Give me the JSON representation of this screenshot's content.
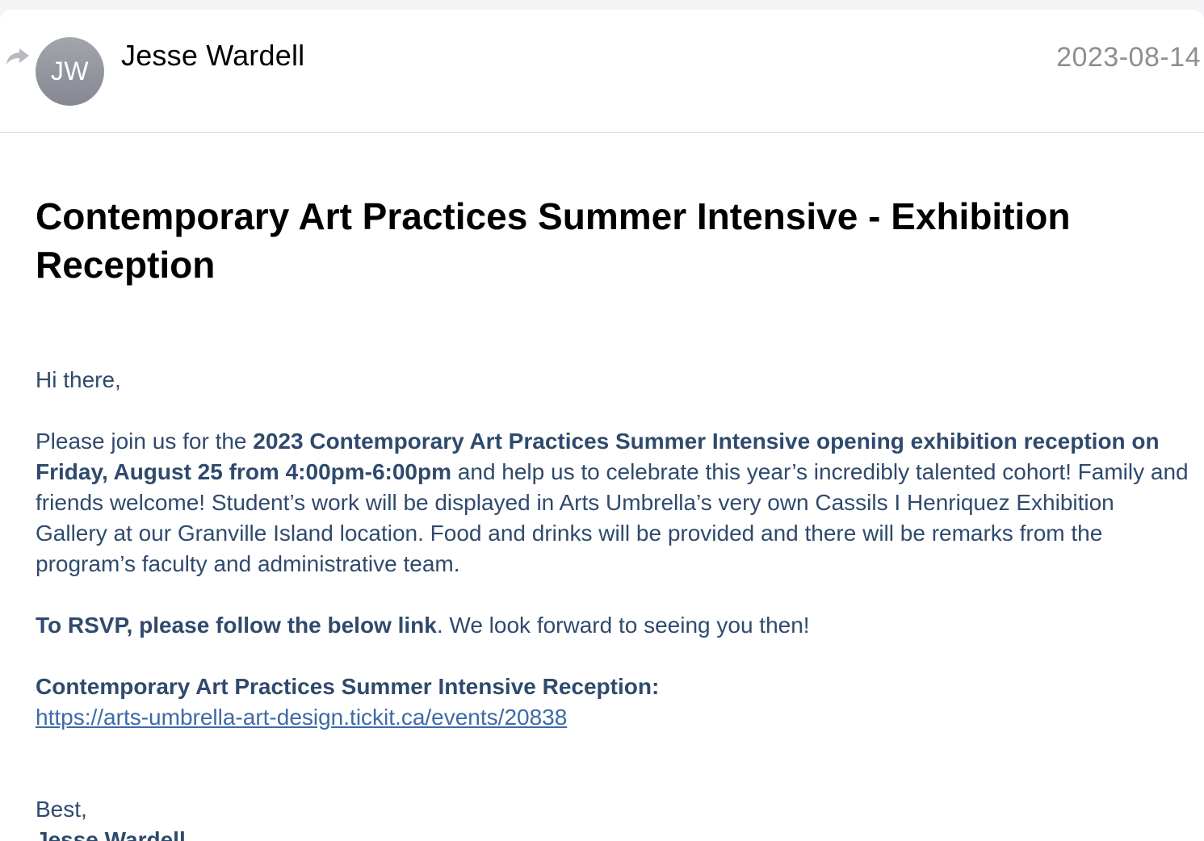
{
  "header": {
    "avatar_initials": "JW",
    "sender_name": "Jesse Wardell",
    "date": "2023-08-14",
    "reply_icon": "reply-arrow-icon"
  },
  "email": {
    "subject": "Contemporary Art Practices Summer Intensive - Exhibition Reception",
    "greeting": "Hi there,",
    "para1_prefix": "Please join us for the ",
    "para1_bold": "2023 Contemporary Art Practices Summer Intensive opening exhibition reception on Friday, August 25 from 4:00pm-6:00pm",
    "para1_suffix": " and help us to celebrate this year’s incredibly talented cohort! Family and friends welcome! Student’s work will be displayed in Arts Umbrella’s very own Cassils I Henriquez Exhibition Gallery at our Granville Island location. Food and drinks will be provided and there will be remarks from the program’s faculty and administrative team.",
    "rsvp_bold": "To RSVP, please follow the below link",
    "rsvp_suffix": ". We look forward to seeing you then!",
    "link_heading": "Contemporary Art Practices Summer Intensive Reception:",
    "link_url": "https://arts-umbrella-art-design.tickit.ca/events/20838",
    "closing": "Best,",
    "signature": "Jesse Wardell"
  },
  "colors": {
    "body_text": "#2f4a6d",
    "link": "#3d6aa8",
    "date": "#8e8e93",
    "avatar": "#8e9099"
  }
}
